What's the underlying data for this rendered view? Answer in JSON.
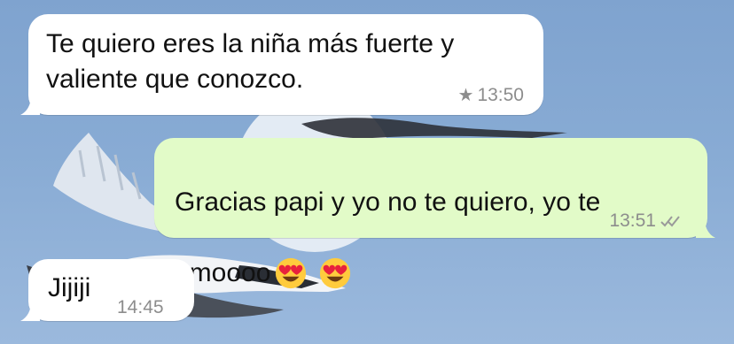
{
  "messages": [
    {
      "direction": "incoming",
      "text": "Te quiero eres la niña más fuerte y\nvaliente que conozco.",
      "time": "13:50",
      "starred": true
    },
    {
      "direction": "outgoing",
      "text_line1": "Gracias papi y yo no te quiero, yo te",
      "text_line2": "amoooo",
      "emojis": [
        "heart-eyes-emoji",
        "heart-eyes-emoji"
      ],
      "time": "13:51",
      "status": "read-double-check"
    },
    {
      "direction": "incoming",
      "text": "Jijiji",
      "time": "14:45",
      "starred": false
    }
  ],
  "colors": {
    "wallpaper_sky": "#88abd4",
    "incoming_bubble": "#ffffff",
    "outgoing_bubble": "#e2fbc8",
    "meta_text": "#8d8d8d"
  },
  "icons": [
    "star-icon",
    "double-check-icon",
    "heart-eyes-emoji"
  ]
}
